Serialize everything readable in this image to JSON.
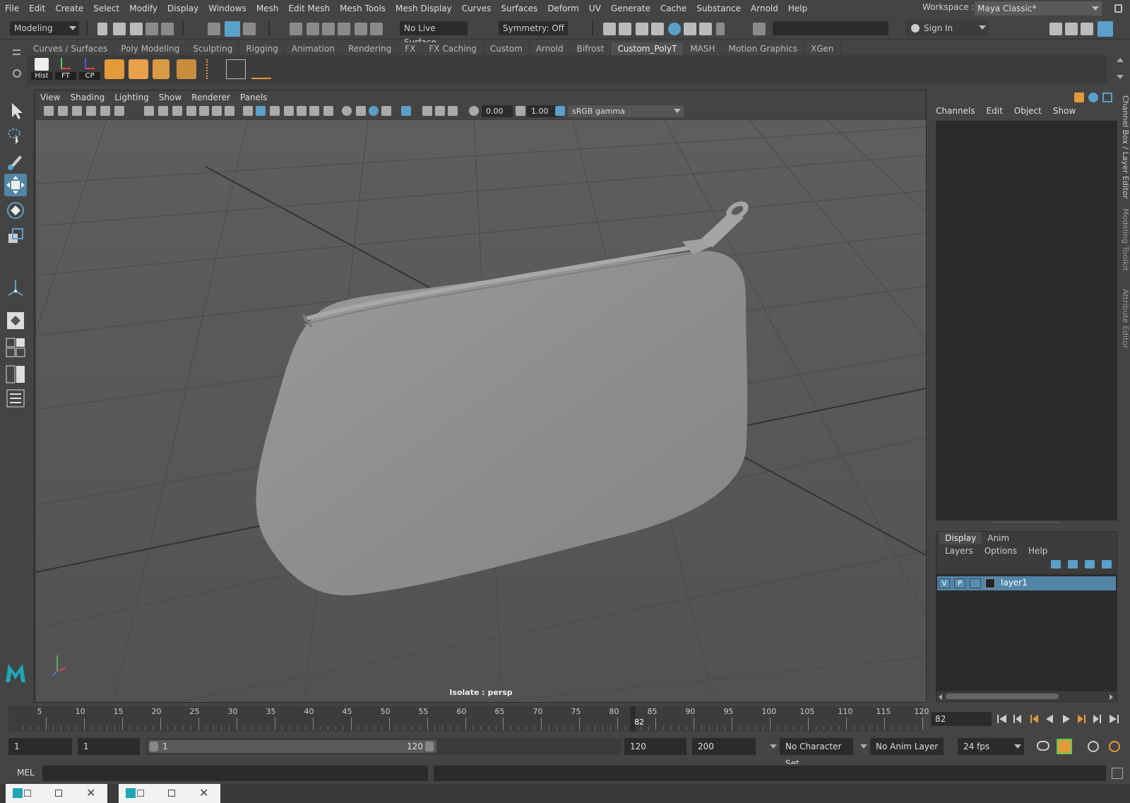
{
  "menu": [
    "File",
    "Edit",
    "Create",
    "Select",
    "Modify",
    "Display",
    "Windows",
    "Mesh",
    "Edit Mesh",
    "Mesh Tools",
    "Mesh Display",
    "Curves",
    "Surfaces",
    "Deform",
    "UV",
    "Generate",
    "Cache",
    "Substance",
    "Arnold",
    "Help"
  ],
  "workspace": {
    "label": "Workspace :",
    "value": "Maya Classic*"
  },
  "status": {
    "mode": "Modeling",
    "live_surface": "No Live Surface",
    "symmetry": "Symmetry: Off",
    "sign_in": "Sign In"
  },
  "shelf": {
    "tabs": [
      "Curves / Surfaces",
      "Poly Modeling",
      "Sculpting",
      "Rigging",
      "Animation",
      "Rendering",
      "FX",
      "FX Caching",
      "Custom",
      "Arnold",
      "Bifrost",
      "Custom_PolyT",
      "MASH",
      "Motion Graphics",
      "XGen"
    ],
    "active_tab": "Custom_PolyT",
    "labeled_icons": [
      "Hist",
      "FT",
      "CP"
    ]
  },
  "viewport": {
    "menu": [
      "View",
      "Shading",
      "Lighting",
      "Show",
      "Renderer",
      "Panels"
    ],
    "exposure": "0.00",
    "gamma": "1.00",
    "color_space": "sRGB gamma",
    "label": "Isolate : persp"
  },
  "channel_box": {
    "menu": [
      "Channels",
      "Edit",
      "Object",
      "Show"
    ]
  },
  "layer_editor": {
    "tabs": [
      "Display",
      "Anim"
    ],
    "menu": [
      "Layers",
      "Options",
      "Help"
    ],
    "layer": {
      "v": "V",
      "p": "P",
      "name": "layer1"
    }
  },
  "side_tabs": [
    "Channel Box / Layer Editor",
    "Modeling Toolkit",
    "Attribute Editor"
  ],
  "timeline": {
    "ticks": [
      "5",
      "10",
      "15",
      "20",
      "25",
      "30",
      "35",
      "40",
      "45",
      "50",
      "55",
      "60",
      "65",
      "70",
      "75",
      "80",
      "85",
      "90",
      "95",
      "100",
      "105",
      "110",
      "115",
      "120"
    ],
    "current_frame": "82",
    "cursor_label": "82",
    "range_start": 1,
    "range_end": 120
  },
  "range": {
    "start": "1",
    "play_start": "1",
    "slider_start": "1",
    "slider_end": "120",
    "play_end": "120",
    "end": "200",
    "character_set": "No Character Set",
    "anim_layer": "No Anim Layer",
    "fps": "24 fps"
  },
  "command": {
    "label": "MEL"
  },
  "colors": {
    "accent": "#5285a6",
    "panel": "#444444",
    "field": "#2b2b2b"
  }
}
